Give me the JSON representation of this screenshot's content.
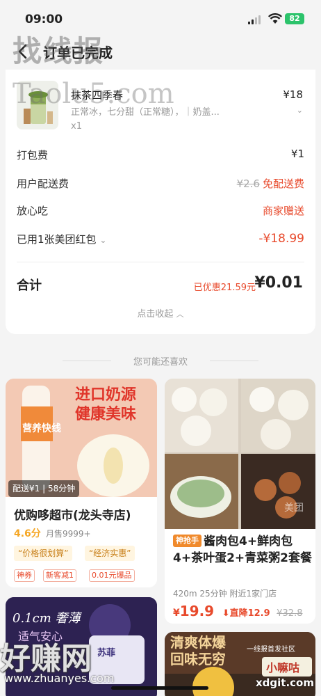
{
  "status_bar": {
    "time": "09:00",
    "battery": "82"
  },
  "nav": {
    "title": "订单已完成"
  },
  "watermarks": {
    "top": "找线报",
    "top2": "Taolu5.com",
    "bottom": "好赚网",
    "bottom_url": "www.zhuanyes.com",
    "bottom_right": "xdgit.com"
  },
  "order": {
    "item": {
      "name": "抹茶四季春",
      "price": "¥18",
      "spec": "正常冰，七分甜（正常糖），｜奶盖...",
      "qty": "x1"
    },
    "packaging": {
      "label": "打包费",
      "value": "¥1"
    },
    "delivery": {
      "label": "用户配送费",
      "original": "¥2.6",
      "value": "免配送费"
    },
    "safe": {
      "label": "放心吃",
      "value": "商家赠送"
    },
    "coupon": {
      "label": "已用1张美团红包",
      "value": "-¥18.99"
    },
    "total": {
      "label": "合计",
      "saved": "已优惠21.59元",
      "value": "¥0.01"
    },
    "collapse": "点击收起"
  },
  "recommend": {
    "title": "您可能还喜欢",
    "cards": [
      {
        "image_text": [
          "进口奶源",
          "健康美味"
        ],
        "bottle_text": "营养快线",
        "delivery": "配送¥1 | 58分钟",
        "name": "优购哆超市(龙头寺店)",
        "rating": "4.6分",
        "monthly": "月售9999+",
        "tags": [
          "“价格很划算”",
          "“经济实惠”"
        ],
        "promos": [
          "神券",
          "新客减1",
          "0.01元爆品"
        ]
      },
      {
        "badge": "神抢手",
        "title": "酱肉包4+鲜肉包4+茶叶蛋2+青菜粥2套餐",
        "meta": "420m 25分钟 附近1家门店",
        "price_symbol": "¥",
        "price": "19.9",
        "drop": "直降12.9",
        "original": "¥32.8",
        "image_text": "美团"
      },
      {
        "image_text": [
          "0.1cm 奢薄",
          "适气安心"
        ],
        "brand": "苏菲"
      },
      {
        "image_text": [
          "清爽体爆",
          "回味无穷"
        ],
        "tag": "一线报首发社区",
        "brand": "小嘛咕"
      }
    ]
  }
}
